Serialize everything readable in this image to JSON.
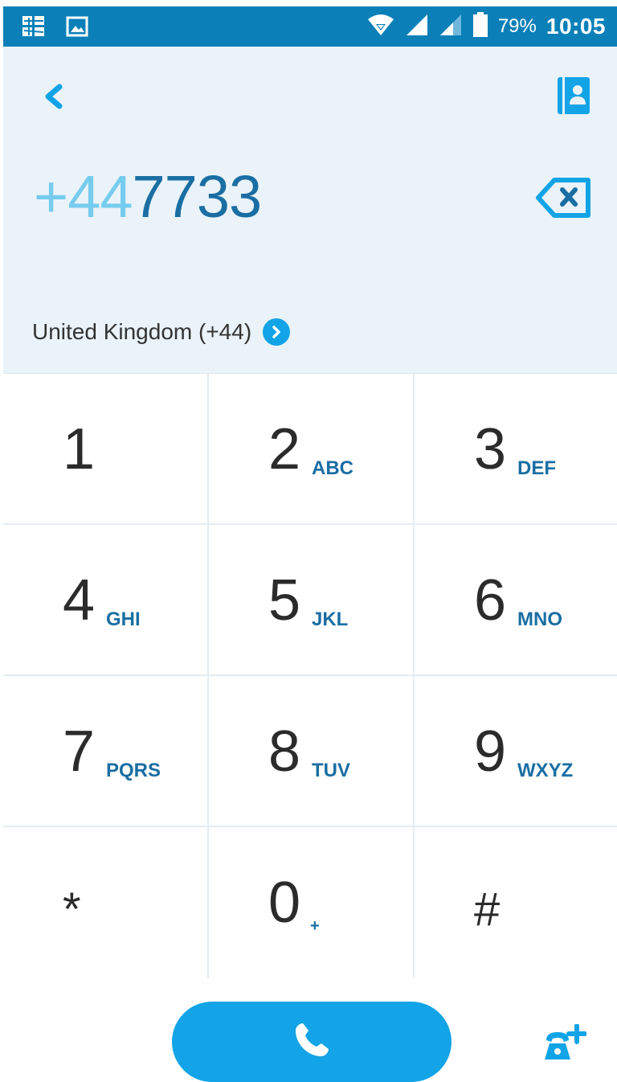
{
  "status_bar": {
    "battery": "79%",
    "time": "10:05",
    "icons": [
      "app-notification-icon",
      "image-icon",
      "wifi-icon",
      "signal-icon",
      "signal-icon-2",
      "battery-icon"
    ]
  },
  "header": {
    "number_prefix": "+44",
    "number_digits": "7733",
    "country": "United Kingdom (+44)"
  },
  "keypad": {
    "keys": [
      {
        "digit": "1",
        "letters": ""
      },
      {
        "digit": "2",
        "letters": "ABC"
      },
      {
        "digit": "3",
        "letters": "DEF"
      },
      {
        "digit": "4",
        "letters": "GHI"
      },
      {
        "digit": "5",
        "letters": "JKL"
      },
      {
        "digit": "6",
        "letters": "MNO"
      },
      {
        "digit": "7",
        "letters": "PQRS"
      },
      {
        "digit": "8",
        "letters": "TUV"
      },
      {
        "digit": "9",
        "letters": "WXYZ"
      },
      {
        "digit": "*",
        "letters": ""
      },
      {
        "digit": "0",
        "letters": "+"
      },
      {
        "digit": "#",
        "letters": ""
      }
    ]
  },
  "colors": {
    "accent": "#12a4e6",
    "status_bar": "#0b80b8",
    "panel_bg": "#eaf3f9",
    "letters": "#1a6ea3"
  }
}
